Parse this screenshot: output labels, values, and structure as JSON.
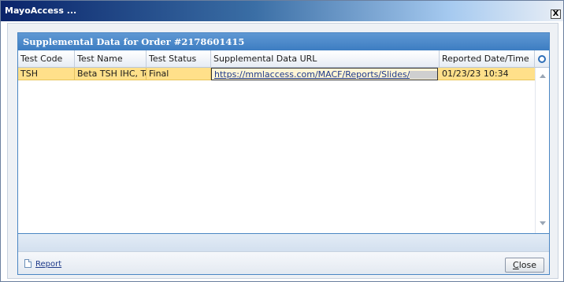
{
  "window": {
    "title": "MayoAccess ...",
    "close_glyph": "X"
  },
  "panel": {
    "title": "Supplemental Data for Order #2178601415"
  },
  "grid": {
    "columns": [
      "Test Code",
      "Test Name",
      "Test Status",
      "Supplemental Data URL",
      "Reported Date/Time"
    ],
    "settings_icon": "settings-icon",
    "rows": [
      {
        "test_code": "TSH",
        "test_name": "Beta TSH IHC, Te",
        "test_status": "Final",
        "url": "https://mmlaccess.com/MACF/Reports/Slides/",
        "url_suffix": "...",
        "reported": "01/23/23 10:34"
      }
    ]
  },
  "footer": {
    "report_label": "Report",
    "close_label_first": "C",
    "close_label_rest": "lose"
  },
  "colors": {
    "selected_row": "#ffe08a",
    "header_blue": "#3d7dc2",
    "link": "#1e3a8a"
  }
}
